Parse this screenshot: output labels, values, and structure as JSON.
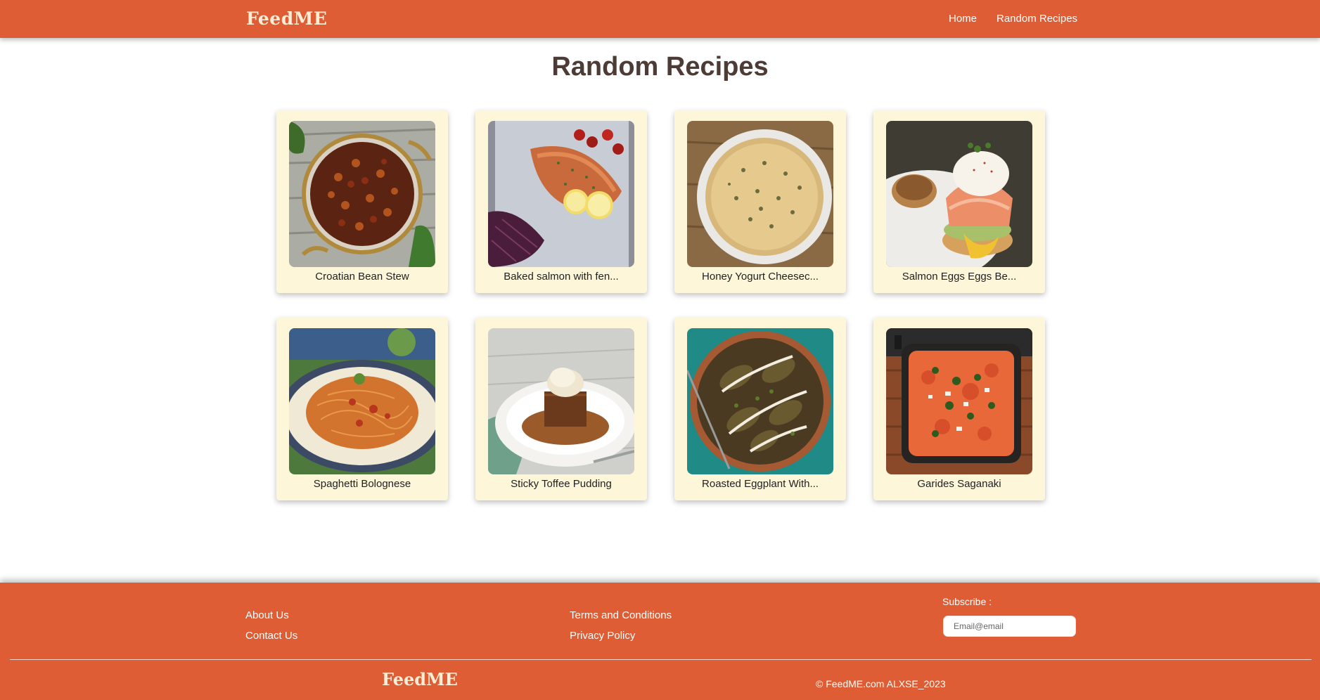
{
  "header": {
    "brand": "FeedME",
    "nav": {
      "home": "Home",
      "random": "Random Recipes"
    }
  },
  "main": {
    "title": "Random Recipes",
    "recipes": [
      {
        "title": "Croatian Bean Stew",
        "image": "bean-stew-photo"
      },
      {
        "title": "Baked salmon with fen...",
        "image": "baked-salmon-photo"
      },
      {
        "title": "Honey Yogurt Cheesec...",
        "image": "cheesecake-photo"
      },
      {
        "title": "Salmon Eggs Eggs Be...",
        "image": "eggs-benedict-photo"
      },
      {
        "title": "Spaghetti Bolognese",
        "image": "spaghetti-photo"
      },
      {
        "title": "Sticky Toffee Pudding",
        "image": "toffee-pudding-photo"
      },
      {
        "title": "Roasted Eggplant With...",
        "image": "roasted-eggplant-photo"
      },
      {
        "title": "Garides Saganaki",
        "image": "saganaki-photo"
      }
    ]
  },
  "footer": {
    "about": "About Us",
    "contact": "Contact Us",
    "terms": "Terms and Conditions",
    "privacy": "Privacy Policy",
    "subscribe_label": "Subscribe :",
    "email_placeholder": "Email@email",
    "brand": "FeedME",
    "copyright": "© FeedME.com ALXSE_2023"
  },
  "colors": {
    "primary": "#df5d35",
    "card_bg": "#fdf6d9",
    "brand_text": "#fbecd5",
    "title_text": "#4d3b35"
  }
}
